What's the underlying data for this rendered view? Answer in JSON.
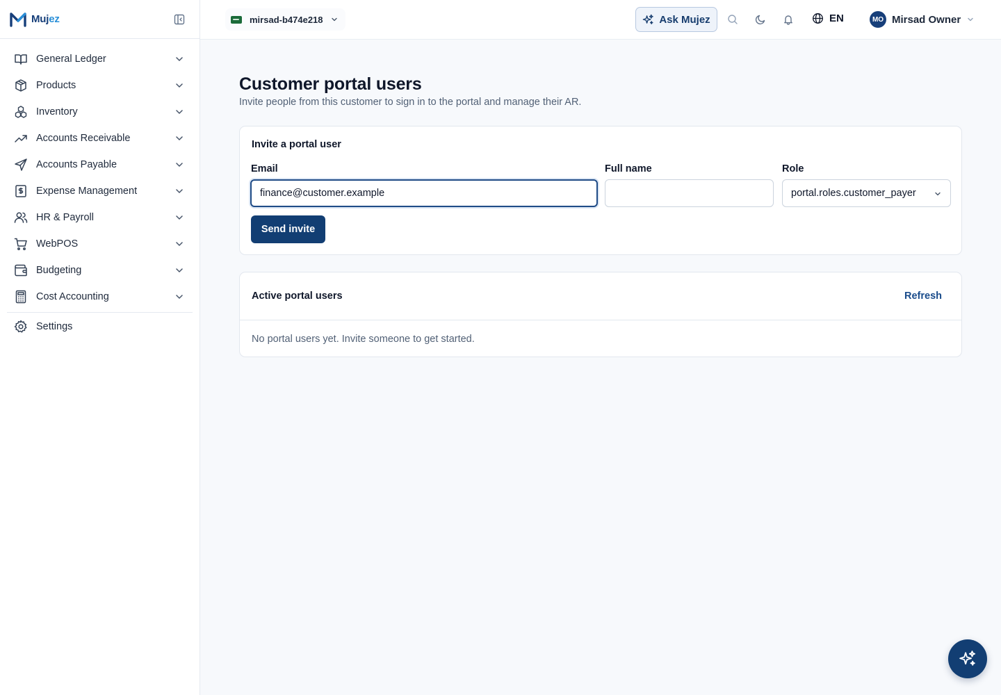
{
  "app": {
    "name_part1": "Muj",
    "name_part2": "ez"
  },
  "sidebar": {
    "items": [
      {
        "label": "General Ledger",
        "icon": "book-open-icon"
      },
      {
        "label": "Products",
        "icon": "package-icon"
      },
      {
        "label": "Inventory",
        "icon": "boxes-icon"
      },
      {
        "label": "Accounts Receivable",
        "icon": "trending-up-icon"
      },
      {
        "label": "Accounts Payable",
        "icon": "send-icon"
      },
      {
        "label": "Expense Management",
        "icon": "receipt-icon"
      },
      {
        "label": "HR & Payroll",
        "icon": "users-icon"
      },
      {
        "label": "WebPOS",
        "icon": "shopping-cart-icon"
      },
      {
        "label": "Budgeting",
        "icon": "wallet-icon"
      },
      {
        "label": "Cost Accounting",
        "icon": "calculator-icon"
      }
    ],
    "settings_label": "Settings"
  },
  "topbar": {
    "org_name": "mirsad-b474e218",
    "ask_label": "Ask Mujez",
    "language": "EN",
    "user_initials": "MO",
    "user_name": "Mirsad Owner"
  },
  "page": {
    "title": "Customer portal users",
    "subtitle": "Invite people from this customer to sign in to the portal and manage their AR."
  },
  "invite": {
    "card_title": "Invite a portal user",
    "email_label": "Email",
    "email_value": "finance@customer.example",
    "fullname_label": "Full name",
    "fullname_value": "",
    "role_label": "Role",
    "role_value": "portal.roles.customer_payer",
    "send_label": "Send invite"
  },
  "active_users": {
    "card_title": "Active portal users",
    "refresh_label": "Refresh",
    "empty_text": "No portal users yet. Invite someone to get started."
  },
  "colors": {
    "brand_dark": "#123e73",
    "brand_light": "#2a8fd8",
    "background": "#f7f9fc"
  }
}
